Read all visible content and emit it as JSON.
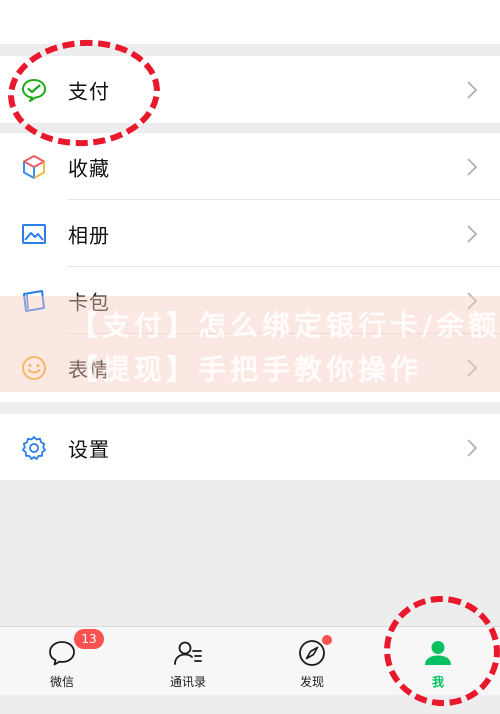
{
  "menu": {
    "pay": {
      "label": "支付",
      "icon": "wechat-pay-icon"
    },
    "favorites": {
      "label": "收藏",
      "icon": "cube-icon"
    },
    "album": {
      "label": "相册",
      "icon": "picture-icon"
    },
    "cards": {
      "label": "卡包",
      "icon": "card-wallet-icon"
    },
    "stickers": {
      "label": "表情",
      "icon": "smiley-icon"
    },
    "settings": {
      "label": "设置",
      "icon": "gear-icon"
    }
  },
  "watermark": {
    "line1": "【支付】怎么绑定银行卡/余额",
    "line2": "【提现】手把手教你操作"
  },
  "tabbar": {
    "chats": {
      "label": "微信",
      "badge": "13",
      "icon": "chat-bubble-icon"
    },
    "contacts": {
      "label": "通讯录",
      "icon": "contacts-icon"
    },
    "discover": {
      "label": "发现",
      "icon": "compass-icon",
      "has_dot": true
    },
    "me": {
      "label": "我",
      "icon": "person-icon",
      "active": true
    }
  },
  "colors": {
    "accent_green": "#07c160",
    "badge_red": "#fa5151",
    "annotation_red": "#e9182c",
    "background": "#ededed"
  }
}
